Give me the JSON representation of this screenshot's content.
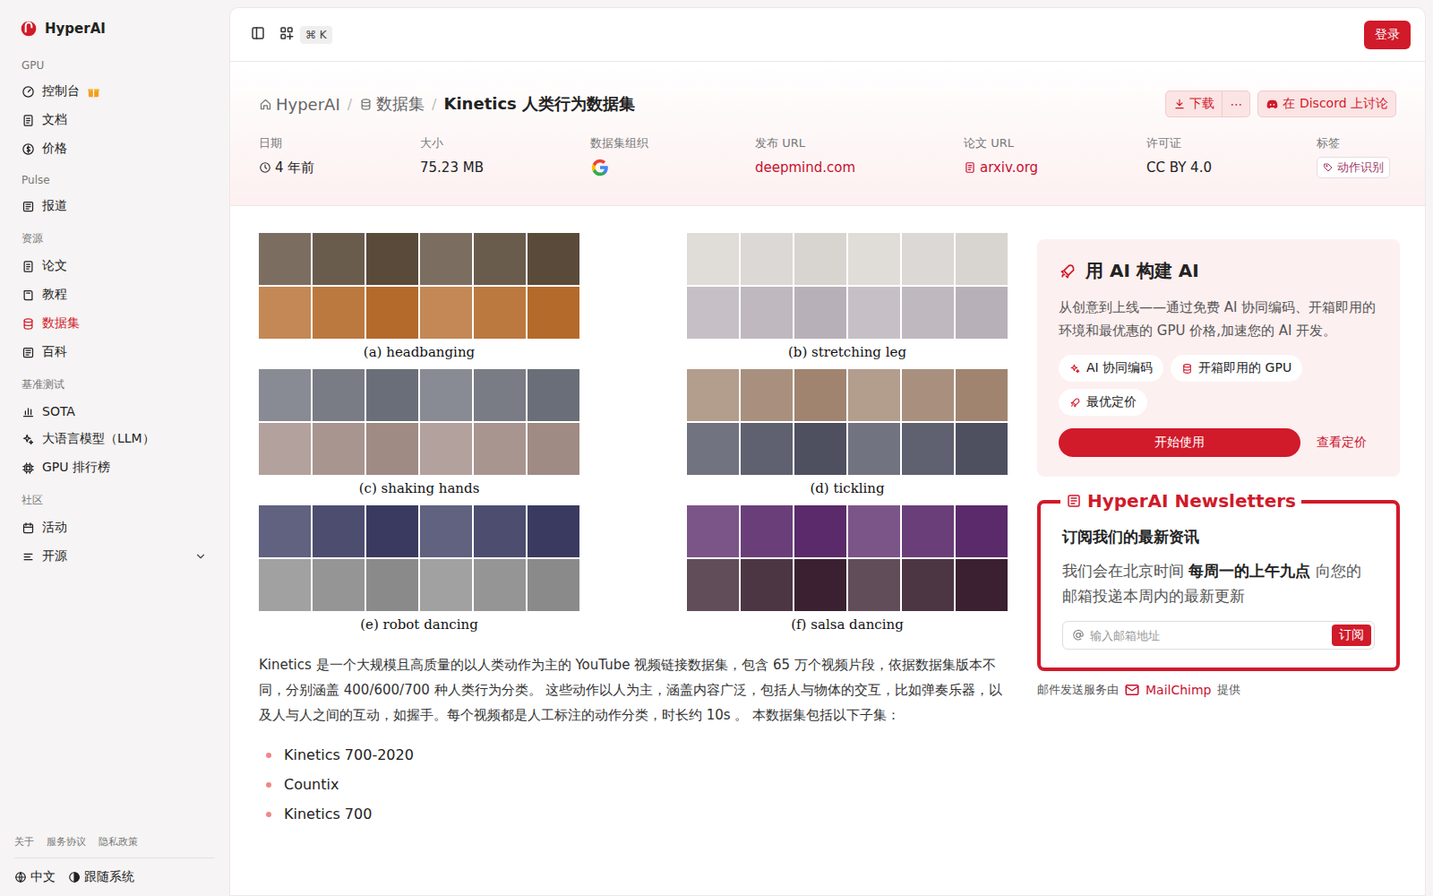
{
  "sidebar": {
    "logo": "HyperAI",
    "sections": [
      {
        "title": "GPU",
        "items": [
          {
            "label": "控制台",
            "selected": false,
            "gift": true
          },
          {
            "label": "文档",
            "selected": false,
            "gift": false
          },
          {
            "label": "价格",
            "selected": false,
            "gift": false
          }
        ]
      },
      {
        "title": "Pulse",
        "items": [
          {
            "label": "报道",
            "selected": false,
            "gift": false
          }
        ]
      },
      {
        "title": "资源",
        "items": [
          {
            "label": "论文",
            "selected": false,
            "gift": false
          },
          {
            "label": "教程",
            "selected": false,
            "gift": false
          },
          {
            "label": "数据集",
            "selected": true,
            "gift": false
          },
          {
            "label": "百科",
            "selected": false,
            "gift": false
          }
        ]
      },
      {
        "title": "基准测试",
        "items": [
          {
            "label": "SOTA",
            "selected": false,
            "gift": false
          },
          {
            "label": "大语言模型（LLM）",
            "selected": false,
            "gift": false
          },
          {
            "label": "GPU 排行榜",
            "selected": false,
            "gift": false
          }
        ]
      },
      {
        "title": "社区",
        "items": [
          {
            "label": "活动",
            "selected": false,
            "gift": false
          },
          {
            "label": "开源",
            "selected": false,
            "gift": false,
            "expanded": false
          }
        ]
      }
    ],
    "footer_links": [
      "关于",
      "服务协议",
      "隐私政策"
    ],
    "language": "中文",
    "theme": "跟随系统"
  },
  "topbar": {
    "shortcut": "⌘ K",
    "login": "登录"
  },
  "breadcrumb": {
    "separator": "/",
    "items": [
      "HyperAI",
      "数据集",
      "Kinetics 人类行为数据集"
    ]
  },
  "actions": {
    "download": "下载",
    "more": "⋯",
    "discord": "在 Discord 上讨论"
  },
  "meta": [
    {
      "label": "日期",
      "value": "4 年前",
      "kind": "time"
    },
    {
      "label": "大小",
      "value": "75.23 MB",
      "kind": "plain"
    },
    {
      "label": "数据集组织",
      "value": "",
      "kind": "logo"
    },
    {
      "label": "发布 URL",
      "value": "deepmind.com",
      "kind": "link"
    },
    {
      "label": "论文 URL",
      "value": "arxiv.org",
      "kind": "paper"
    },
    {
      "label": "许可证",
      "value": "CC BY 4.0",
      "kind": "plain"
    },
    {
      "label": "标签",
      "value": "动作识别",
      "kind": "tag"
    }
  ],
  "figure": {
    "panels": [
      "(a) headbanging",
      "(b) stretching leg",
      "(c) shaking hands",
      "(d) tickling",
      "(e) robot dancing",
      "(f) salsa dancing"
    ]
  },
  "description": "Kinetics 是一个大规模且高质量的以人类动作为主的 YouTube 视频链接数据集，包含 65 万个视频片段，依据数据集版本不同，分别涵盖 400/600/700 种人类行为分类。 这些动作以人为主，涵盖内容广泛，包括人与物体的交互，比如弹奏乐器，以及人与人之间的互动，如握手。每个视频都是人工标注的动作分类，时长约 10s 。 本数据集包括以下子集：",
  "subsets": [
    "Kinetics 700-2020",
    "Countix",
    "Kinetics 700"
  ],
  "promo": {
    "title": "用 AI 构建 AI",
    "text": "从创意到上线——通过免费 AI 协同编码、开箱即用的环境和最优惠的 GPU 价格,加速您的 AI 开发。",
    "features": [
      "AI 协同编码",
      "开箱即用的 GPU",
      "最优定价"
    ],
    "start": "开始使用",
    "pricing": "查看定价"
  },
  "newsletter": {
    "title": "HyperAI Newsletters",
    "heading": "订阅我们的最新资讯",
    "text_before": "我们会在北京时间 ",
    "text_bold": "每周一的上午九点",
    "text_after": " 向您的邮箱投递本周内的最新更新",
    "placeholder": "输入邮箱地址",
    "button": "订阅",
    "footer_before": "邮件发送服务由",
    "footer_link": "MailChimp",
    "footer_after": "提供"
  }
}
